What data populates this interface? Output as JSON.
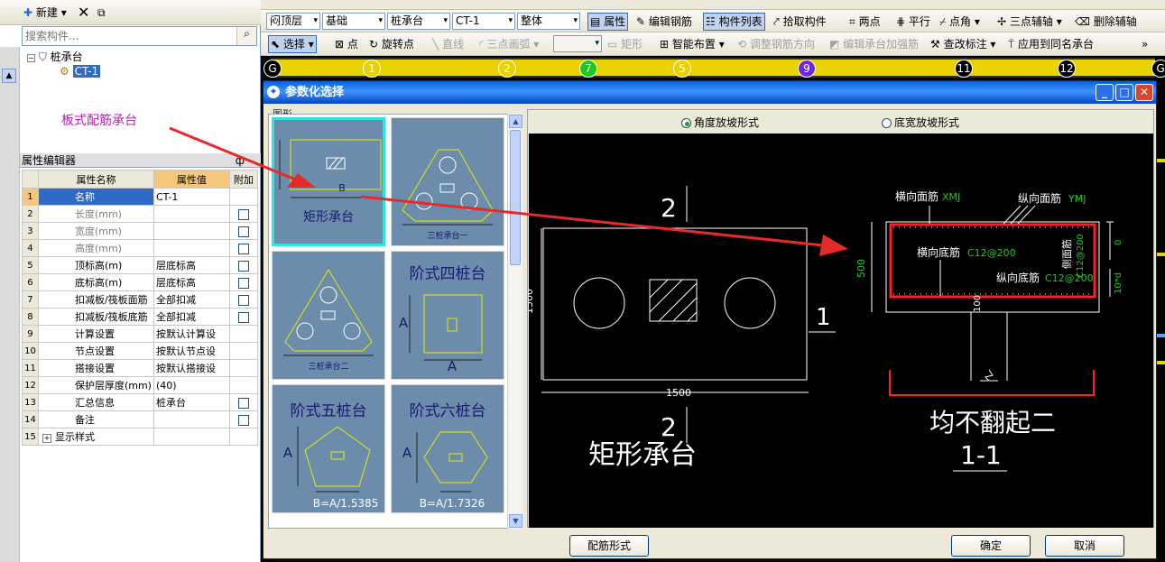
{
  "left_panel": {
    "toolbar": {
      "new_label": "新建",
      "delete_icon": "close-icon",
      "copy_icon": "copy-icon"
    },
    "search": {
      "placeholder": "搜索构件..."
    },
    "tree": {
      "root": "桩承台",
      "child": "CT-1"
    },
    "annotation": "板式配筋承台",
    "property_editor": {
      "title": "属性编辑器",
      "pin": "ф",
      "columns": [
        "属性名称",
        "属性值",
        "附加"
      ],
      "rows": [
        {
          "n": "1",
          "name": "名称",
          "value": "CT-1",
          "check": false
        },
        {
          "n": "2",
          "name": "长度(mm)",
          "value": "",
          "check": true
        },
        {
          "n": "3",
          "name": "宽度(mm)",
          "value": "",
          "check": true
        },
        {
          "n": "4",
          "name": "高度(mm)",
          "value": "",
          "check": true
        },
        {
          "n": "5",
          "name": "顶标高(m)",
          "value": "层底标高",
          "check": true
        },
        {
          "n": "6",
          "name": "底标高(m)",
          "value": "层底标高",
          "check": true
        },
        {
          "n": "7",
          "name": "扣减板/筏板面筋",
          "value": "全部扣减",
          "check": true
        },
        {
          "n": "8",
          "name": "扣减板/筏板底筋",
          "value": "全部扣减",
          "check": true
        },
        {
          "n": "9",
          "name": "计算设置",
          "value": "按默认计算设",
          "check": false
        },
        {
          "n": "10",
          "name": "节点设置",
          "value": "按默认节点设",
          "check": false
        },
        {
          "n": "11",
          "name": "搭接设置",
          "value": "按默认搭接设",
          "check": false
        },
        {
          "n": "12",
          "name": "保护层厚度(mm)",
          "value": "(40)",
          "check": false
        },
        {
          "n": "13",
          "name": "汇总信息",
          "value": "桩承台",
          "check": true
        },
        {
          "n": "14",
          "name": "备注",
          "value": "",
          "check": true
        },
        {
          "n": "15",
          "name": "显示样式",
          "value": "",
          "check": false
        }
      ]
    }
  },
  "toolbar_row1": {
    "floor": "闷顶层",
    "category": "基础",
    "type": "桩承台",
    "element": "CT-1",
    "layer": "整体",
    "buttons": [
      "属性",
      "编辑钢筋",
      "构件列表",
      "拾取构件",
      "两点",
      "平行",
      "点角",
      "三点辅轴",
      "删除辅轴"
    ]
  },
  "toolbar_row2": {
    "buttons": [
      "选择",
      "点",
      "旋转点",
      "直线",
      "三点画弧",
      "矩形",
      "智能布置",
      "调整钢筋方向",
      "编辑承台加强筋",
      "查改标注",
      "应用到同名承台"
    ]
  },
  "axis_labels": [
    "G",
    "1",
    "2",
    "7",
    "5",
    "9",
    "11",
    "12",
    "G"
  ],
  "dialog": {
    "title": "参数化选择",
    "section_label": "图形",
    "tiles": [
      {
        "label": "矩形承台",
        "dim": "B"
      },
      {
        "label": "三桩承台一",
        "dim": ""
      },
      {
        "label": "三桩承台二",
        "dim": ""
      },
      {
        "label": "阶式四桩台",
        "dim": "A"
      },
      {
        "label": "阶式五桩台",
        "dim": "B=A/1.5385"
      },
      {
        "label": "阶式六桩台",
        "dim": "B=A/1.7326"
      }
    ],
    "radio_options": [
      {
        "label": "角度放坡形式",
        "selected": true
      },
      {
        "label": "底宽放坡形式",
        "selected": false
      }
    ],
    "preview": {
      "section_mark": "2",
      "cut_mark": "1",
      "plan_width": "1500",
      "plan_height": "1500",
      "plan_caption": "矩形承台",
      "section_height": "500",
      "cover_top": "0",
      "cover_bottom": "100",
      "side_cover": "10*d",
      "top_x_label": "横向面筋",
      "top_x_value": "XMJ",
      "top_y_label": "纵向面筋",
      "top_y_value": "YMJ",
      "bot_x_label": "横向底筋",
      "bot_x_value": "C12@200",
      "bot_y_label": "纵向底筋",
      "bot_y_value": "C12@200",
      "side_label": "侧面筋",
      "side_value": "C12@200",
      "section_caption": "均不翻起二",
      "section_title": "1-1"
    },
    "buttons": {
      "rebar_form": "配筋形式",
      "ok": "确定",
      "cancel": "取消"
    }
  },
  "colors": {
    "accent_title": "#0a5fd8",
    "tile_bg": "#6b8cab",
    "rebar_red": "#ff2020",
    "annotation": "#c01cc0"
  }
}
